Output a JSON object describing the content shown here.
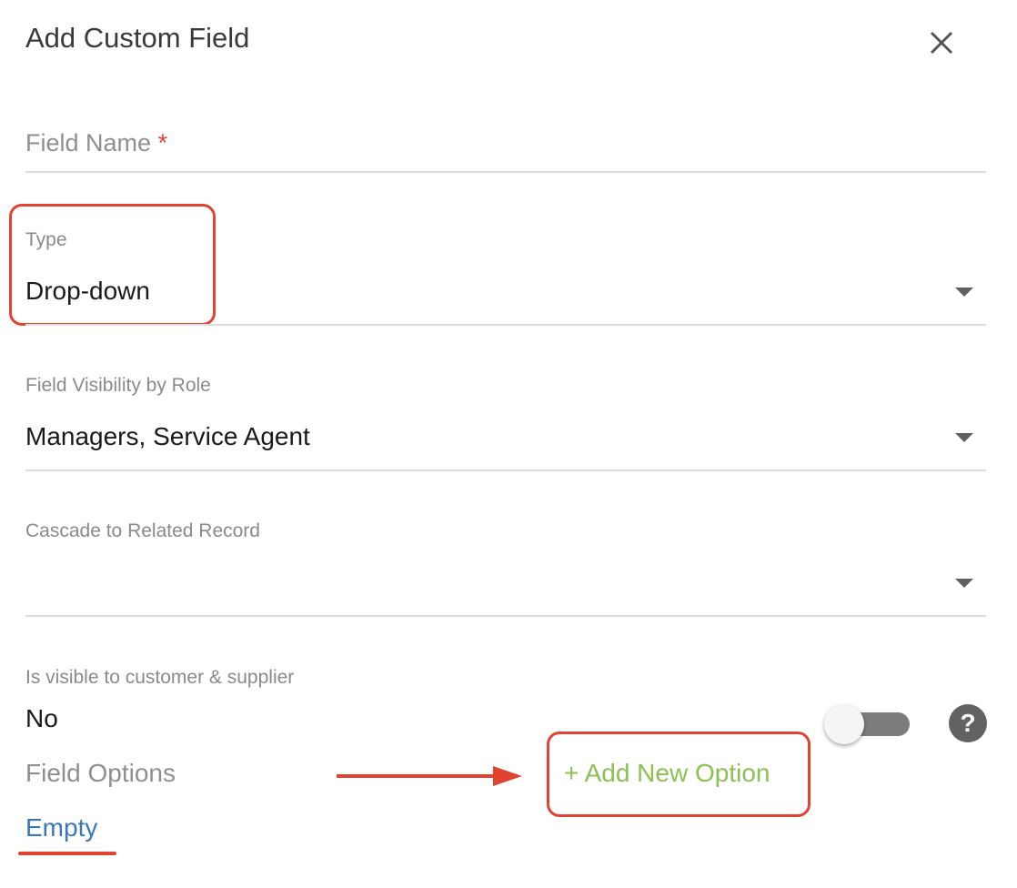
{
  "dialog": {
    "title": "Add Custom Field"
  },
  "fields": {
    "field_name": {
      "placeholder": "Field Name",
      "required_mark": "*"
    },
    "type": {
      "label": "Type",
      "value": "Drop-down"
    },
    "visibility": {
      "label": "Field Visibility by Role",
      "value": "Managers, Service Agent"
    },
    "cascade": {
      "label": "Cascade to Related Record",
      "value": ""
    },
    "visible_to_customer": {
      "label": "Is visible to customer & supplier",
      "value": "No",
      "toggle_on": false
    }
  },
  "help": {
    "symbol": "?"
  },
  "options": {
    "label": "Field Options",
    "add_label": "+ Add New Option",
    "empty_label": "Empty"
  },
  "icons": {
    "close": "close-icon",
    "caret": "caret-down-icon",
    "help": "question-icon",
    "arrow": "arrow-right-icon"
  },
  "colors": {
    "annotation": "#e0432f",
    "add_option": "#8cc152",
    "empty_link": "#3a77b8",
    "toggle_track": "#7c7c7c"
  }
}
